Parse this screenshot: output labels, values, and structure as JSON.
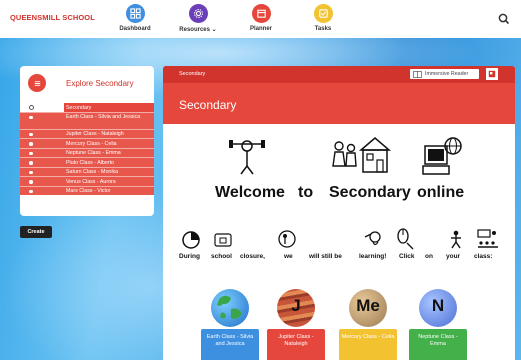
{
  "brand": "QUEENSMILL SCHOOL",
  "nav": [
    {
      "label": "Dashboard",
      "color": "#3d8fe0",
      "icon": "grid-icon"
    },
    {
      "label": "Resources",
      "color": "#6b3fb8",
      "icon": "gear-icon"
    },
    {
      "label": "Planner",
      "color": "#e5473d",
      "icon": "calendar-icon"
    },
    {
      "label": "Tasks",
      "color": "#f2c230",
      "icon": "checklist-icon"
    }
  ],
  "sidebar": {
    "title": "Explore Secondary",
    "items": [
      {
        "label": "Secondary",
        "active": true
      },
      {
        "label": "Earth Class - Silvia and Jessica",
        "active": false
      },
      {
        "label": "Jupiter Class - Nataleigh",
        "active": false
      },
      {
        "label": "Mercury Class - Celia",
        "active": false
      },
      {
        "label": "Neptune Class - Emma",
        "active": false
      },
      {
        "label": "Pluto Class - Alberto",
        "active": false
      },
      {
        "label": "Saturn Class - Monika",
        "active": false
      },
      {
        "label": "Venus Class - Aurora",
        "active": false
      },
      {
        "label": "Mars Class - Victor",
        "active": false
      }
    ],
    "create_label": "Create"
  },
  "main": {
    "breadcrumb": "Secondary",
    "immersive_reader": "Immersive Reader",
    "title": "Secondary",
    "welcome_words": [
      "Welcome",
      "to",
      "Secondary",
      "online"
    ],
    "sentence_words": [
      "During",
      "school",
      "closure,",
      "we",
      "will still be",
      "learning!",
      "Click",
      "on",
      "your",
      "class:"
    ],
    "classes": [
      {
        "label": "Earth Class - Silvia and Jessica",
        "color": "#3d8fe0",
        "letter": ""
      },
      {
        "label": "Jupiter Class - Nataleigh",
        "color": "#e5473d",
        "letter": "J"
      },
      {
        "label": "Mercury Class - Celia",
        "color": "#f2c230",
        "letter": "Me"
      },
      {
        "label": "Neptune Class - Emma",
        "color": "#43b04a",
        "letter": "N"
      }
    ]
  },
  "colors": {
    "accent": "#e5473d",
    "accent_dark": "#d0342c"
  }
}
